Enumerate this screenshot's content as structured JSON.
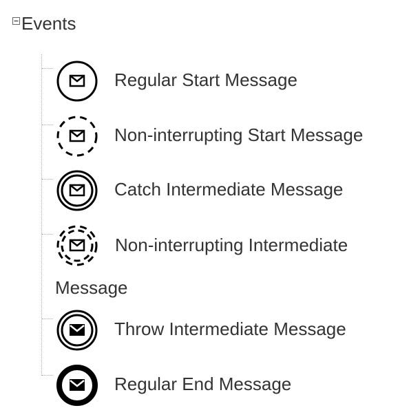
{
  "tree": {
    "root_label": "Events",
    "items": [
      {
        "label": "Regular Start Message",
        "icon": "message-start-event-icon"
      },
      {
        "label": "Non-interrupting Start Message",
        "icon": "message-start-non-interrupting-icon"
      },
      {
        "label": "Catch Intermediate Message",
        "icon": "message-intermediate-catch-icon"
      },
      {
        "label": "Non-interrupting Intermediate Message",
        "icon": "message-intermediate-non-interrupting-icon"
      },
      {
        "label": "Throw Intermediate Message",
        "icon": "message-intermediate-throw-icon"
      },
      {
        "label": "Regular End Message",
        "icon": "message-end-event-icon"
      }
    ]
  },
  "colors": {
    "text": "#333333",
    "icon": "#000000",
    "tree_lines": "#aaaaaa"
  }
}
